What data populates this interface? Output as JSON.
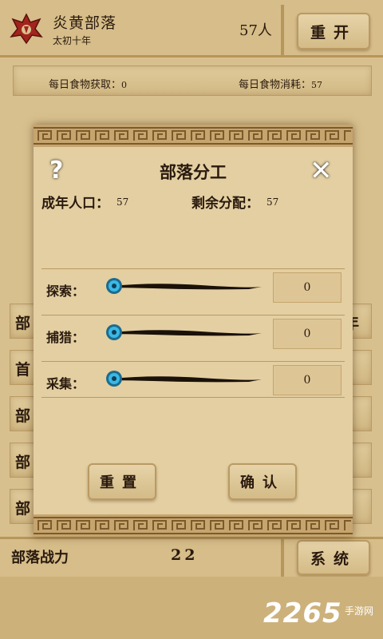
{
  "header": {
    "tribe_name": "炎黄部落",
    "era": "太初十年",
    "population": "57人",
    "restart_label": "重开"
  },
  "food": {
    "gain_label": "每日食物获取：",
    "gain_value": "0",
    "cost_label": "每日食物消耗：",
    "cost_value": "57"
  },
  "background_list": {
    "left_items": [
      "部",
      "首",
      "部",
      "部",
      "部"
    ],
    "right_items": [
      "年",
      "",
      "",
      "",
      ""
    ]
  },
  "bottom": {
    "power_label": "部落战力",
    "power_value": "22",
    "system_label": "系统"
  },
  "dialog": {
    "help_icon": "?",
    "close_icon": "✕",
    "title": "部落分工",
    "adult_label": "成年人口：",
    "adult_value": "57",
    "remain_label": "剩余分配：",
    "remain_value": "57",
    "jobs": [
      {
        "label": "探索：",
        "value": "0"
      },
      {
        "label": "捕猎：",
        "value": "0"
      },
      {
        "label": "采集：",
        "value": "0"
      }
    ],
    "reset_label": "重置",
    "confirm_label": "确认"
  },
  "watermark": {
    "brand": "2265",
    "sub": "手游网"
  },
  "colors": {
    "parchment": "#e0cb9c",
    "border": "#b99a63",
    "slider_knob": "#3ab8e6",
    "ink": "#1a1108"
  }
}
